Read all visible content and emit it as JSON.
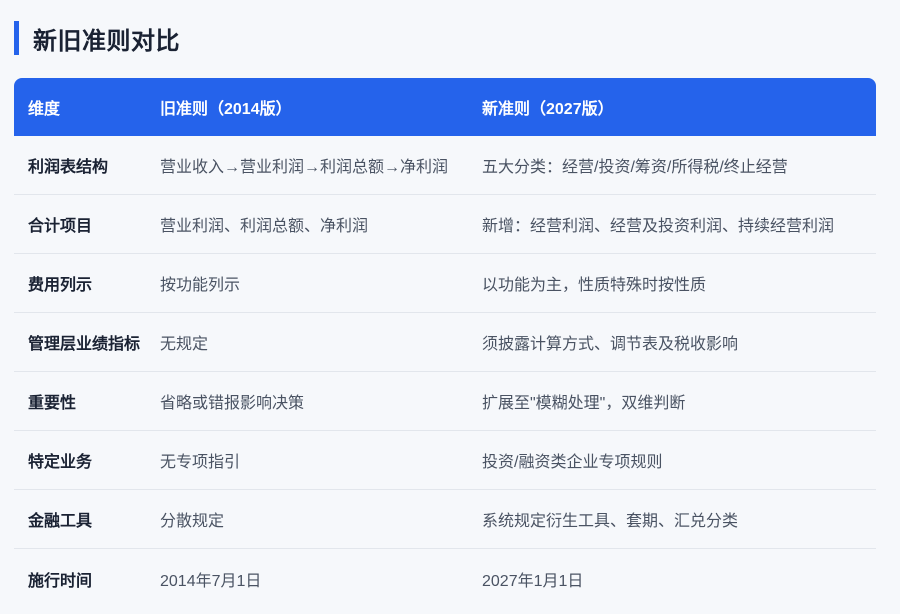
{
  "title": "新旧准则对比",
  "headers": [
    "维度",
    "旧准则（2014版）",
    "新准则（2027版）"
  ],
  "rows": [
    {
      "dimension": "利润表结构",
      "old": "营业收入→营业利润→利润总额→净利润",
      "new": "五大分类：经营/投资/筹资/所得税/终止经营"
    },
    {
      "dimension": "合计项目",
      "old": "营业利润、利润总额、净利润",
      "new": "新增：经营利润、经营及投资利润、持续经营利润"
    },
    {
      "dimension": "费用列示",
      "old": "按功能列示",
      "new": "以功能为主，性质特殊时按性质"
    },
    {
      "dimension": "管理层业绩指标",
      "old": "无规定",
      "new": "须披露计算方式、调节表及税收影响"
    },
    {
      "dimension": "重要性",
      "old": "省略或错报影响决策",
      "new": "扩展至\"模糊处理\"，双维判断"
    },
    {
      "dimension": "特定业务",
      "old": "无专项指引",
      "new": "投资/融资类企业专项规则"
    },
    {
      "dimension": "金融工具",
      "old": "分散规定",
      "new": "系统规定衍生工具、套期、汇兑分类"
    },
    {
      "dimension": "施行时间",
      "old": "2014年7月1日",
      "new": "2027年1月1日"
    }
  ],
  "colors": {
    "accent": "#2563eb",
    "background": "#f6f8fb",
    "text_primary": "#1a2233",
    "text_secondary": "#4a5363",
    "divider": "#e2e6ec"
  }
}
